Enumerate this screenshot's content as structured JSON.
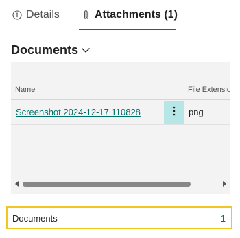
{
  "tabs": [
    {
      "label": "Details",
      "icon": "info-icon",
      "active": false
    },
    {
      "label": "Attachments (1)",
      "icon": "paperclip-icon",
      "active": true
    }
  ],
  "section": {
    "title": "Documents"
  },
  "grid": {
    "columns": [
      "Name",
      "File Extension"
    ],
    "rows": [
      {
        "name": "Screenshot 2024-12-17 110828",
        "extension": "png"
      }
    ]
  },
  "cue": {
    "label": "Documents",
    "value": "1"
  },
  "colors": {
    "accent": "#00706b",
    "cue_border": "#f2c622",
    "row_menu_bg": "#b6e6e6",
    "panel_bg": "#f3f3f3"
  }
}
